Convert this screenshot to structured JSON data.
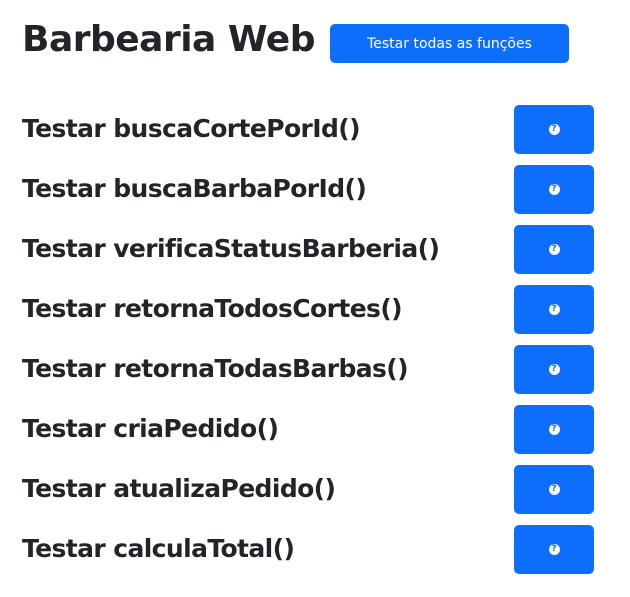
{
  "header": {
    "title": "Barbearia Web",
    "test_all_label": "Testar todas as funções"
  },
  "tests": [
    {
      "label": "Testar buscaCortePorId()",
      "icon": "question-circle-icon"
    },
    {
      "label": "Testar buscaBarbaPorId()",
      "icon": "question-circle-icon"
    },
    {
      "label": "Testar verificaStatusBarberia()",
      "icon": "question-circle-icon"
    },
    {
      "label": "Testar retornaTodosCortes()",
      "icon": "question-circle-icon"
    },
    {
      "label": "Testar retornaTodasBarbas()",
      "icon": "question-circle-icon"
    },
    {
      "label": "Testar criaPedido()",
      "icon": "question-circle-icon"
    },
    {
      "label": "Testar atualizaPedido()",
      "icon": "question-circle-icon"
    },
    {
      "label": "Testar calculaTotal()",
      "icon": "question-circle-icon"
    }
  ],
  "colors": {
    "primary": "#0d6efd",
    "text": "#212529",
    "background": "#ffffff"
  }
}
